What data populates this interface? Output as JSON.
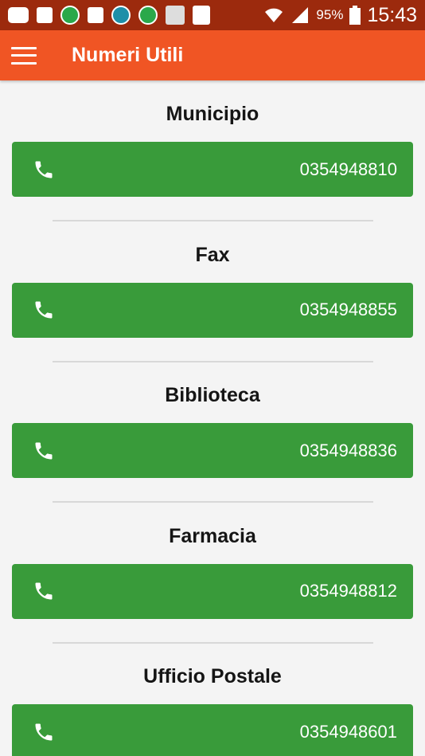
{
  "status_bar": {
    "icons": [
      "chat-icon",
      "facebook-icon",
      "app-icon",
      "gallery-icon",
      "app-icon",
      "app-icon",
      "app-icon",
      "flag-icon",
      "wifi-icon",
      "signal-icon"
    ],
    "battery": "95%",
    "time": "15:43"
  },
  "app_bar": {
    "title": "Numeri Utili",
    "menu_icon": "hamburger-icon",
    "color": "#f05524"
  },
  "button_color": "#399b3a",
  "entries": [
    {
      "name": "Municipio",
      "number": "0354948810"
    },
    {
      "name": "Fax",
      "number": "0354948855"
    },
    {
      "name": "Biblioteca",
      "number": "0354948836"
    },
    {
      "name": "Farmacia",
      "number": "0354948812"
    },
    {
      "name": "Ufficio Postale",
      "number": "0354948601"
    }
  ]
}
